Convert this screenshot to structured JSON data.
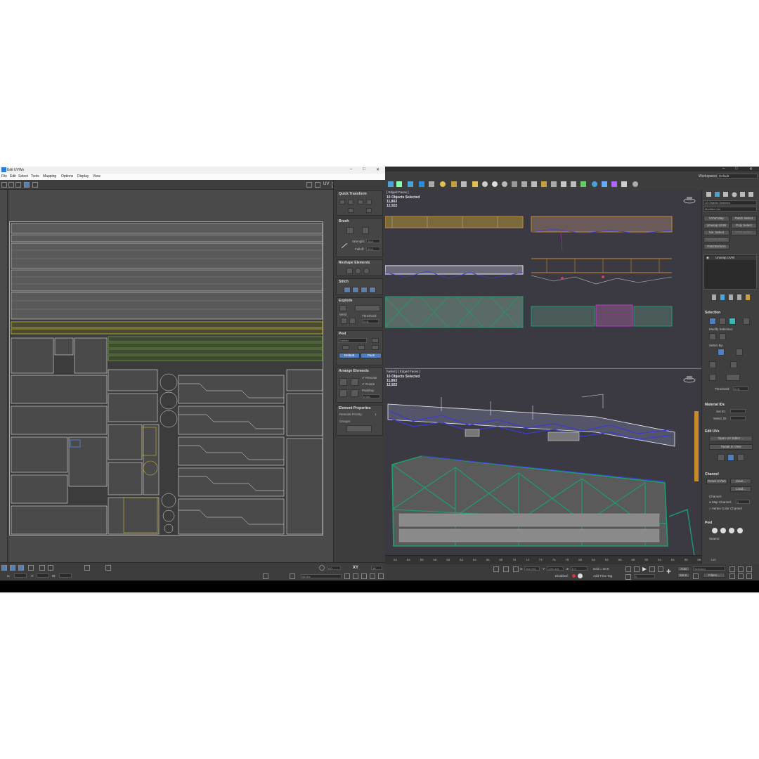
{
  "uv_window": {
    "title": "Edit UVWs",
    "menu": [
      "File",
      "Edit",
      "Select",
      "Tools",
      "Mapping",
      "Options",
      "Display",
      "View"
    ],
    "toolbar_uv_label": "UV",
    "map_dropdown": "Map #838 ( _Color.png)",
    "panel": {
      "quick_transform": "Quick Transform",
      "brush": "Brush",
      "strength_label": "Strength:",
      "strength_value": "10.0",
      "falloff_label": "Falloff:",
      "falloff_value": "20.0",
      "reshape": "Reshape Elements",
      "stitch": "Stitch",
      "explode": "Explode",
      "weld_label": "Weld",
      "threshold_label": "Threshold:",
      "threshold_value": "0.01",
      "peel": "Peel",
      "peel_dropdown": "Unfold",
      "peel_default": "Default",
      "peel_pack": "Pack",
      "arrange": "Arrange Elements",
      "rescale": "Rescale",
      "rotate": "Rotate",
      "padding_label": "Padding:",
      "padding_value": "0.001",
      "element_props": "Element Properties",
      "rescale_priority": "Rescale Priority:",
      "rescale_priority_value": "1",
      "groups": "Groups:"
    },
    "status": {
      "u_label": "U:",
      "v_label": "V:",
      "w_label": "W:",
      "value": "0.0",
      "xy_label": "XY",
      "xy_value": "16",
      "ids_dropdown": "All IDs"
    }
  },
  "max": {
    "workspaces_label": "Workspaces:",
    "workspaces_value": "Default",
    "top_viewport": {
      "label": "[ Edged Faces ]",
      "selected": "10 Objects Selected",
      "count1": "11,863",
      "count2": "12,922"
    },
    "bottom_viewport": {
      "label": "haded ] [ Edged Faces ]",
      "selected": "10 Objects Selected",
      "count1": "11,863",
      "count2": "12,922"
    },
    "command_panel": {
      "objects_selected": "10 Objects Selected",
      "modifier_list": "Modifier List",
      "buttons": [
        "UVW Map",
        "Patch Select",
        "Unwrap UVW",
        "Poly Select",
        "Vol. Select",
        "FFD Select",
        "Surface Select",
        "PatchDeform"
      ],
      "stack_item": "Unwrap UVW",
      "selection": "Selection",
      "modify_selection": "Modify Selection:",
      "select_by": "Select By:",
      "threshold_label": "Threshold:",
      "threshold_value": "0.01",
      "material_ids": "Material IDs",
      "set_id": "Set ID:",
      "select_id": "Select ID:",
      "edit_uvs": "Edit UVs",
      "open_uv_editor": "Open UV Editor ...",
      "tweak_in_view": "Tweak In View",
      "channel": "Channel",
      "reset_uvws": "Reset UVWs",
      "save": "Save...",
      "load": "Load...",
      "channel_label": "Channel:",
      "map_channel": "Map Channel:",
      "map_channel_value": "1",
      "vertex_color_channel": "Vertex Color Channel",
      "peel": "Peel",
      "seams": "Seams:"
    },
    "timeline_ticks": [
      "52",
      "54",
      "56",
      "58",
      "60",
      "62",
      "64",
      "66",
      "68",
      "70",
      "72",
      "74",
      "76",
      "78",
      "80",
      "82",
      "84",
      "86",
      "88",
      "90",
      "92",
      "94",
      "96",
      "98",
      "100"
    ],
    "status": {
      "x_label": "X:",
      "x_value": "264.725",
      "y_label": "Y:",
      "y_value": "-231.401",
      "z_label": "Z:",
      "z_value": "0.0",
      "grid": "Grid = 10.0",
      "disabled": "Disabled:",
      "add_time_tag": "Add Time Tag",
      "auto": "Auto",
      "set_k": "Set K.",
      "selected": "Selected",
      "filters": "Filters...",
      "frame": "0"
    }
  },
  "colors": {
    "panel_bg": "#444444",
    "viewport_bg": "#3b3a42",
    "uv_wire": "#d8d8d8",
    "uv_yellow": "#c9b83a",
    "uv_green": "#6f9c3a",
    "mesh_green": "#1f9c6e",
    "mesh_blue": "#3b3bd6",
    "mesh_orange": "#c88a2a",
    "mesh_magenta": "#b43fc8",
    "accent_blue": "#4f7fc0"
  }
}
